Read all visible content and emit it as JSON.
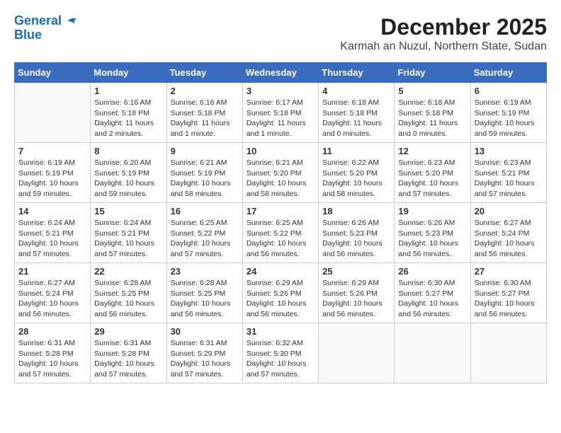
{
  "logo": {
    "line1": "General",
    "line2": "Blue"
  },
  "title": "December 2025",
  "location": "Karmah an Nuzul, Northern State, Sudan",
  "headers": [
    "Sunday",
    "Monday",
    "Tuesday",
    "Wednesday",
    "Thursday",
    "Friday",
    "Saturday"
  ],
  "weeks": [
    [
      {
        "day": "",
        "info": ""
      },
      {
        "day": "1",
        "info": "Sunrise: 6:16 AM\nSunset: 5:18 PM\nDaylight: 11 hours\nand 2 minutes."
      },
      {
        "day": "2",
        "info": "Sunrise: 6:16 AM\nSunset: 5:18 PM\nDaylight: 11 hours\nand 1 minute."
      },
      {
        "day": "3",
        "info": "Sunrise: 6:17 AM\nSunset: 5:18 PM\nDaylight: 11 hours\nand 1 minute."
      },
      {
        "day": "4",
        "info": "Sunrise: 6:18 AM\nSunset: 5:18 PM\nDaylight: 11 hours\nand 0 minutes."
      },
      {
        "day": "5",
        "info": "Sunrise: 6:18 AM\nSunset: 5:18 PM\nDaylight: 11 hours\nand 0 minutes."
      },
      {
        "day": "6",
        "info": "Sunrise: 6:19 AM\nSunset: 5:19 PM\nDaylight: 10 hours\nand 59 minutes."
      }
    ],
    [
      {
        "day": "7",
        "info": "Sunrise: 6:19 AM\nSunset: 5:19 PM\nDaylight: 10 hours\nand 59 minutes."
      },
      {
        "day": "8",
        "info": "Sunrise: 6:20 AM\nSunset: 5:19 PM\nDaylight: 10 hours\nand 59 minutes."
      },
      {
        "day": "9",
        "info": "Sunrise: 6:21 AM\nSunset: 5:19 PM\nDaylight: 10 hours\nand 58 minutes."
      },
      {
        "day": "10",
        "info": "Sunrise: 6:21 AM\nSunset: 5:20 PM\nDaylight: 10 hours\nand 58 minutes."
      },
      {
        "day": "11",
        "info": "Sunrise: 6:22 AM\nSunset: 5:20 PM\nDaylight: 10 hours\nand 58 minutes."
      },
      {
        "day": "12",
        "info": "Sunrise: 6:23 AM\nSunset: 5:20 PM\nDaylight: 10 hours\nand 57 minutes."
      },
      {
        "day": "13",
        "info": "Sunrise: 6:23 AM\nSunset: 5:21 PM\nDaylight: 10 hours\nand 57 minutes."
      }
    ],
    [
      {
        "day": "14",
        "info": "Sunrise: 6:24 AM\nSunset: 5:21 PM\nDaylight: 10 hours\nand 57 minutes."
      },
      {
        "day": "15",
        "info": "Sunrise: 6:24 AM\nSunset: 5:21 PM\nDaylight: 10 hours\nand 57 minutes."
      },
      {
        "day": "16",
        "info": "Sunrise: 6:25 AM\nSunset: 5:22 PM\nDaylight: 10 hours\nand 57 minutes."
      },
      {
        "day": "17",
        "info": "Sunrise: 6:25 AM\nSunset: 5:22 PM\nDaylight: 10 hours\nand 56 minutes."
      },
      {
        "day": "18",
        "info": "Sunrise: 6:26 AM\nSunset: 5:23 PM\nDaylight: 10 hours\nand 56 minutes."
      },
      {
        "day": "19",
        "info": "Sunrise: 6:26 AM\nSunset: 5:23 PM\nDaylight: 10 hours\nand 56 minutes."
      },
      {
        "day": "20",
        "info": "Sunrise: 6:27 AM\nSunset: 5:24 PM\nDaylight: 10 hours\nand 56 minutes."
      }
    ],
    [
      {
        "day": "21",
        "info": "Sunrise: 6:27 AM\nSunset: 5:24 PM\nDaylight: 10 hours\nand 56 minutes."
      },
      {
        "day": "22",
        "info": "Sunrise: 6:28 AM\nSunset: 5:25 PM\nDaylight: 10 hours\nand 56 minutes."
      },
      {
        "day": "23",
        "info": "Sunrise: 6:28 AM\nSunset: 5:25 PM\nDaylight: 10 hours\nand 56 minutes."
      },
      {
        "day": "24",
        "info": "Sunrise: 6:29 AM\nSunset: 5:26 PM\nDaylight: 10 hours\nand 56 minutes."
      },
      {
        "day": "25",
        "info": "Sunrise: 6:29 AM\nSunset: 5:26 PM\nDaylight: 10 hours\nand 56 minutes."
      },
      {
        "day": "26",
        "info": "Sunrise: 6:30 AM\nSunset: 5:27 PM\nDaylight: 10 hours\nand 56 minutes."
      },
      {
        "day": "27",
        "info": "Sunrise: 6:30 AM\nSunset: 5:27 PM\nDaylight: 10 hours\nand 56 minutes."
      }
    ],
    [
      {
        "day": "28",
        "info": "Sunrise: 6:31 AM\nSunset: 5:28 PM\nDaylight: 10 hours\nand 57 minutes."
      },
      {
        "day": "29",
        "info": "Sunrise: 6:31 AM\nSunset: 5:28 PM\nDaylight: 10 hours\nand 57 minutes."
      },
      {
        "day": "30",
        "info": "Sunrise: 6:31 AM\nSunset: 5:29 PM\nDaylight: 10 hours\nand 57 minutes."
      },
      {
        "day": "31",
        "info": "Sunrise: 6:32 AM\nSunset: 5:30 PM\nDaylight: 10 hours\nand 57 minutes."
      },
      {
        "day": "",
        "info": ""
      },
      {
        "day": "",
        "info": ""
      },
      {
        "day": "",
        "info": ""
      }
    ]
  ]
}
